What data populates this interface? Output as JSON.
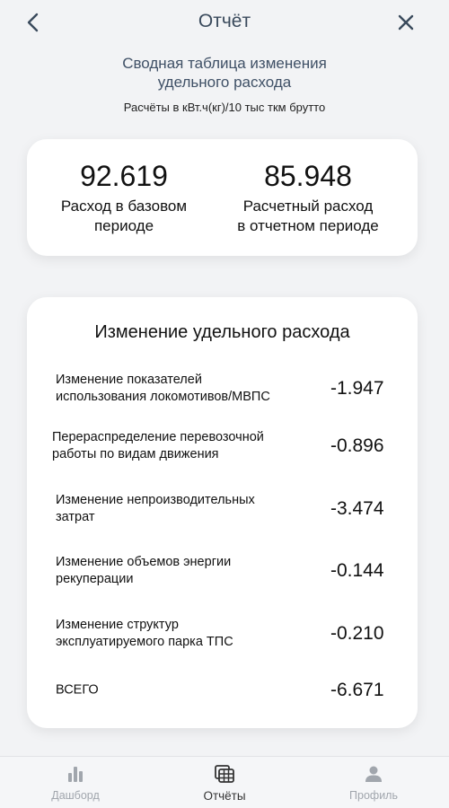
{
  "header": {
    "title": "Отчёт",
    "back_icon": "chevron-left-icon",
    "close_icon": "close-icon"
  },
  "report": {
    "subtitle_line1": "Сводная таблица изменения",
    "subtitle_line2": "удельного расхода",
    "units": "Расчёты в кВт.ч(кг)/10 тыс ткм брутто"
  },
  "summary": {
    "base": {
      "value": "92.619",
      "label_line1": "Расход в базовом",
      "label_line2": "периоде"
    },
    "reporting": {
      "value": "85.948",
      "label_line1": "Расчетный расход",
      "label_line2": "в отчетном периоде"
    }
  },
  "changes": {
    "title": "Изменение удельного расхода",
    "rows": [
      {
        "label_line1": "Изменение показателей",
        "label_line2": "использования локомотивов/МВПС",
        "value": "-1.947"
      },
      {
        "label_line1": "Перераспределение перевозочной",
        "label_line2": "работы по видам движения",
        "value": "-0.896"
      },
      {
        "label_line1": "Изменение непроизводительных",
        "label_line2": "затрат",
        "value": "-3.474"
      },
      {
        "label_line1": "Изменение объемов энергии",
        "label_line2": "рекуперации",
        "value": "-0.144"
      },
      {
        "label_line1": "Изменение структур",
        "label_line2": "эксплуатируемого парка ТПС",
        "value": "-0.210"
      },
      {
        "label_line1": "ВСЕГО",
        "label_line2": "",
        "value": "-6.671"
      }
    ]
  },
  "nav": {
    "items": [
      {
        "label": "Дашборд",
        "icon": "bar-chart-icon",
        "active": false
      },
      {
        "label": "Отчёты",
        "icon": "table-icon",
        "active": true
      },
      {
        "label": "Профиль",
        "icon": "person-icon",
        "active": false
      }
    ]
  },
  "colors": {
    "background": "#f2f3f5",
    "card": "#ffffff",
    "title": "#3a4a5c",
    "nav_inactive": "#a1a6ad",
    "nav_active": "#333333"
  }
}
